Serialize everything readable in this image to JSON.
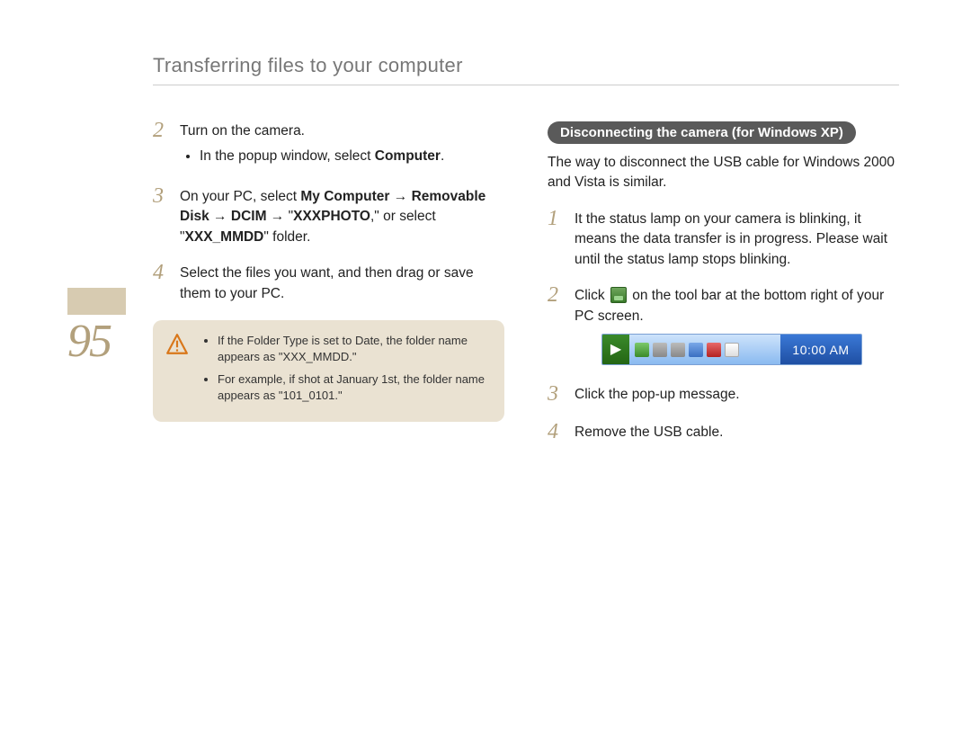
{
  "header": {
    "title": "Transferring files to your computer"
  },
  "page_number": "95",
  "left": {
    "step2": {
      "num": "2",
      "text": "Turn on the camera.",
      "bullet1_pre": "In the popup window, select ",
      "bullet1_bold": "Computer",
      "bullet1_post": "."
    },
    "step3": {
      "num": "3",
      "line1_pre": "On your PC, select ",
      "line1_b1": "My Computer",
      "arrow": " → ",
      "line2_b1": "Removable Disk",
      "line2_b2": "DCIM",
      "line2_q": "\"",
      "line2_b3": "XXXPHOTO",
      "line2_post": ",\" or select \"",
      "line2_b4": "XXX_MMDD",
      "line2_tail": "\" folder."
    },
    "step4": {
      "num": "4",
      "text": "Select the files you want, and then drag or save them to your PC."
    },
    "note": {
      "li1": "If the Folder Type is set to Date, the folder name appears as \"XXX_MMDD.\"",
      "li2": "For example, if shot at January 1st, the folder name appears as \"101_0101.\""
    }
  },
  "right": {
    "section_title": "Disconnecting the camera (for Windows XP)",
    "intro": "The way to disconnect the USB cable for Windows 2000 and Vista is similar.",
    "step1": {
      "num": "1",
      "text": "It the status lamp on your camera is blinking, it means the data transfer is in progress. Please wait until the status lamp stops blinking."
    },
    "step2": {
      "num": "2",
      "pre": "Click ",
      "post": " on the tool bar at the bottom right of your PC screen."
    },
    "taskbar_clock": "10:00 AM",
    "step3": {
      "num": "3",
      "text": "Click the pop-up message."
    },
    "step4": {
      "num": "4",
      "text": "Remove the USB cable."
    }
  }
}
